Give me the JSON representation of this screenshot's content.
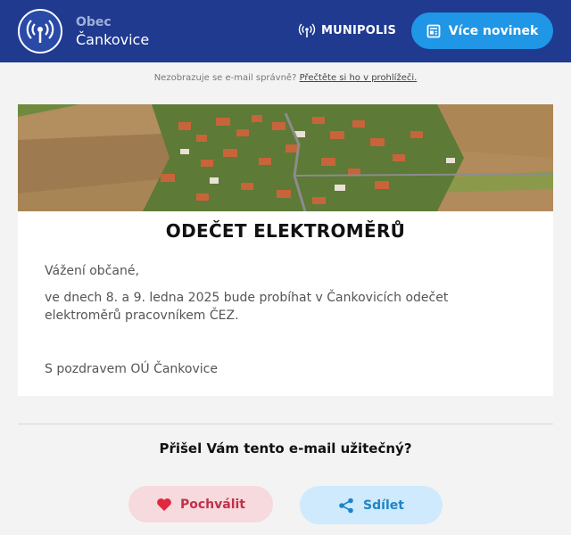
{
  "header": {
    "org_prefix": "Obec",
    "org_name": "Čankovice",
    "brand": "MUNIPOLIS",
    "more_news_label": "Více novinek"
  },
  "preheader": {
    "text": "Nezobrazuje se e-mail správně?",
    "link": "Přečtěte si ho v prohlížeči."
  },
  "article": {
    "title": "ODEČET ELEKTROMĚRŮ",
    "greeting": "Vážení občané,",
    "body": "ve dnech 8. a 9. ledna 2025 bude probíhat v Čankovicích odečet elektroměrů pracovníkem ČEZ.",
    "signature": "S pozdravem OÚ Čankovice"
  },
  "feedback": {
    "question": "Přišel Vám tento e-mail užitečný?",
    "praise_label": "Pochválit",
    "share_label": "Sdílet"
  },
  "colors": {
    "header_bg": "#1f3a8f",
    "accent_blue": "#1f96e6",
    "praise_bg": "#f6dadd",
    "praise_text": "#c2304a",
    "share_bg": "#cfeafc",
    "share_text": "#1f84c9"
  }
}
